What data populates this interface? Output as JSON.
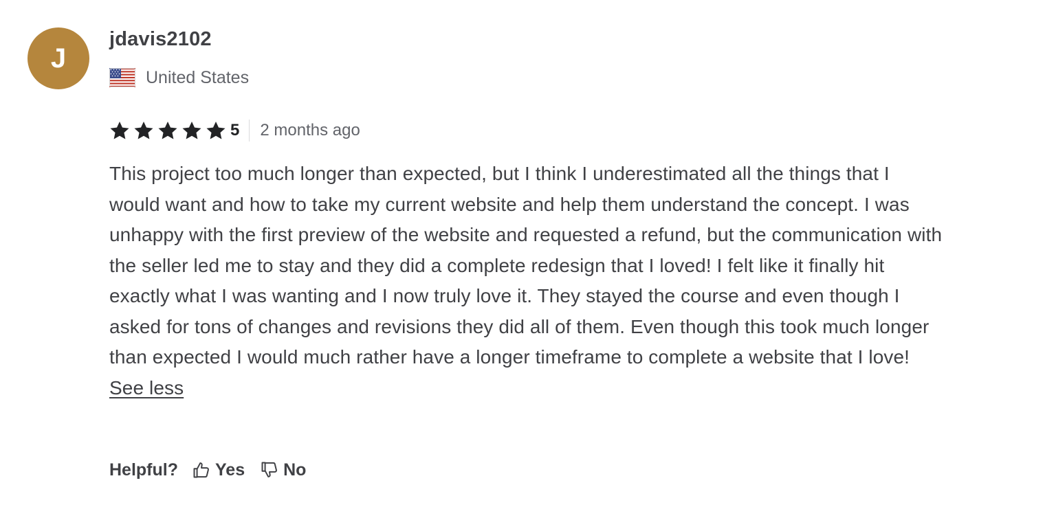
{
  "reviewer": {
    "initial": "J",
    "username": "jdavis2102",
    "country": "United States",
    "flag_icon": "us-flag-icon",
    "avatar_color": "#b5863d"
  },
  "rating": {
    "stars": 5,
    "score_label": "5",
    "date": "2 months ago",
    "star_icon": "star-icon",
    "star_color": "#222325"
  },
  "review": {
    "text": "This project too much longer than expected, but I think I underestimated all the things that I would want and how to take my current website and help them understand the concept. I was unhappy with the first preview of the website and requested a refund, but the communication with the seller led me to stay and they did a complete redesign that I loved! I felt like it finally hit exactly what I was wanting and I now truly love it. They stayed the course and even though I asked for tons of changes and revisions they did all of them. Even though this took much longer than expected I would much rather have a longer timeframe to complete a website that I love!",
    "see_less_label": "See less"
  },
  "helpful": {
    "label": "Helpful?",
    "yes_label": "Yes",
    "no_label": "No",
    "yes_icon": "thumbs-up-icon",
    "no_icon": "thumbs-down-icon"
  }
}
